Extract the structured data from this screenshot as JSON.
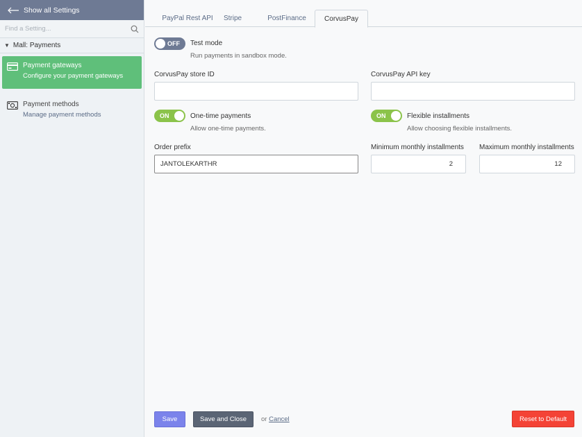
{
  "sidebar": {
    "back_label": "Show all Settings",
    "search_placeholder": "Find a Setting...",
    "group_label": "Mall: Payments",
    "items": [
      {
        "title": "Payment gateways",
        "description": "Configure your payment gateways",
        "icon": "credit-card-icon",
        "active": true
      },
      {
        "title": "Payment methods",
        "description": "Manage payment methods",
        "icon": "money-icon",
        "active": false
      }
    ]
  },
  "tabs": [
    {
      "label": "PayPal Rest API",
      "active": false
    },
    {
      "label": "Stripe",
      "active": false
    },
    {
      "label": "PostFinance",
      "active": false
    },
    {
      "label": "CorvusPay",
      "active": true
    }
  ],
  "form": {
    "test_mode": {
      "state_label": "OFF",
      "label": "Test mode",
      "hint": "Run payments in sandbox mode."
    },
    "store_id": {
      "label": "CorvusPay store ID",
      "value": ""
    },
    "api_key": {
      "label": "CorvusPay API key",
      "value": ""
    },
    "one_time": {
      "state_label": "ON",
      "label": "One-time payments",
      "hint": "Allow one-time payments."
    },
    "flexible": {
      "state_label": "ON",
      "label": "Flexible installments",
      "hint": "Allow choosing flexible installments."
    },
    "order_prefix": {
      "label": "Order prefix",
      "value": "JANTOLEKARTHR"
    },
    "min_installments": {
      "label": "Minimum monthly installments",
      "value": "2"
    },
    "max_installments": {
      "label": "Maximum monthly installments",
      "value": "12"
    }
  },
  "footer": {
    "save_label": "Save",
    "save_close_label": "Save and Close",
    "or_text": "or",
    "cancel_label": "Cancel",
    "reset_label": "Reset to Default"
  },
  "colors": {
    "sidebar_header": "#6e7a94",
    "active_item": "#5fbf7a",
    "toggle_on": "#8bc34a",
    "toggle_off": "#6e7a94",
    "save_button": "#7b83eb",
    "save_close_button": "#5b6575",
    "reset_button": "#f44336"
  }
}
